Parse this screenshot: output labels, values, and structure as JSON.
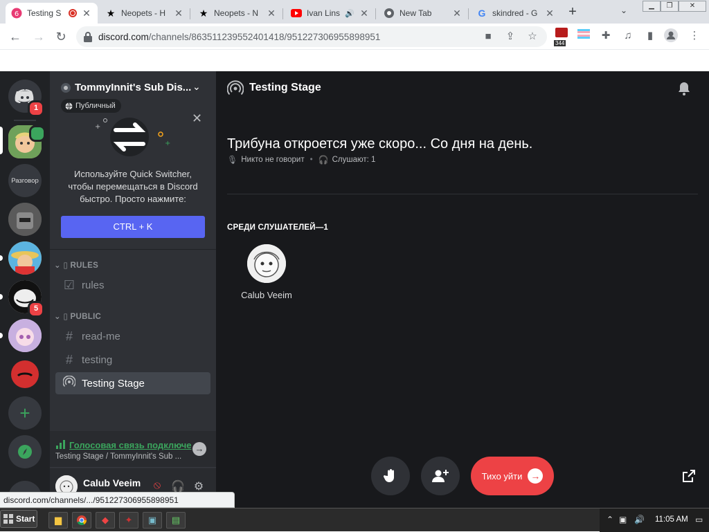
{
  "browser": {
    "tabs": [
      {
        "title": "Testing S",
        "favicon": "discord-recording-icon",
        "favicon_badge": "6",
        "active": true
      },
      {
        "title": "Neopets - H",
        "favicon": "neopets-star-icon"
      },
      {
        "title": "Neopets - N",
        "favicon": "neopets-star-icon"
      },
      {
        "title": "Ivan Lins",
        "favicon": "youtube-icon",
        "audio": true
      },
      {
        "title": "New Tab",
        "favicon": "chrome-icon"
      },
      {
        "title": "skindred - G",
        "favicon": "google-icon"
      }
    ],
    "new_tab_symbol": "+",
    "url_domain": "discord.com",
    "url_path": "/channels/863511239552401418/951227306955898951",
    "extension_badge": "344",
    "status_bar_url": "discord.com/channels/.../951227306955898951"
  },
  "discord": {
    "rail": {
      "home_badge": "1",
      "talk_server_label": "Разговор",
      "trollface_badge": "5"
    },
    "server": {
      "name": "TommyInnit's Sub Dis...",
      "public_badge": "Публичный"
    },
    "quick_switcher": {
      "text": "Используйте Quick Switcher, чтобы перемещаться в Discord быстро. Просто нажмите:",
      "button": "CTRL + K"
    },
    "categories": [
      {
        "name": "▯ RULES",
        "channels": [
          {
            "name": "rules",
            "icon": "rules-checkbox-icon"
          }
        ]
      },
      {
        "name": "▯ PUBLIC",
        "channels": [
          {
            "name": "read-me",
            "icon": "hash-icon"
          },
          {
            "name": "testing",
            "icon": "hash-icon"
          },
          {
            "name": "Testing Stage",
            "icon": "stage-icon",
            "selected": true
          }
        ]
      }
    ],
    "voice": {
      "status": "Голосовая связь подключе",
      "location": "Testing Stage / TommyInnit's Sub ..."
    },
    "user": {
      "name": "Calub Veeim"
    },
    "stage": {
      "title": "Testing Stage",
      "topic": "Трибуна откроется уже скоро... Со дня на день.",
      "nobody_speaking": "Никто не говорит",
      "listening": "Слушают: 1",
      "audience_heading": "СРЕДИ СЛУШАТЕЛЕЙ—1",
      "listeners": [
        {
          "name": "Calub Veeim"
        }
      ],
      "leave_button": "Тихо уйти"
    },
    "colors": {
      "blurple": "#5865f2",
      "green": "#3ba55d",
      "red": "#ed4245"
    }
  },
  "taskbar": {
    "start_label": "Start",
    "clock": "11:05 AM"
  }
}
